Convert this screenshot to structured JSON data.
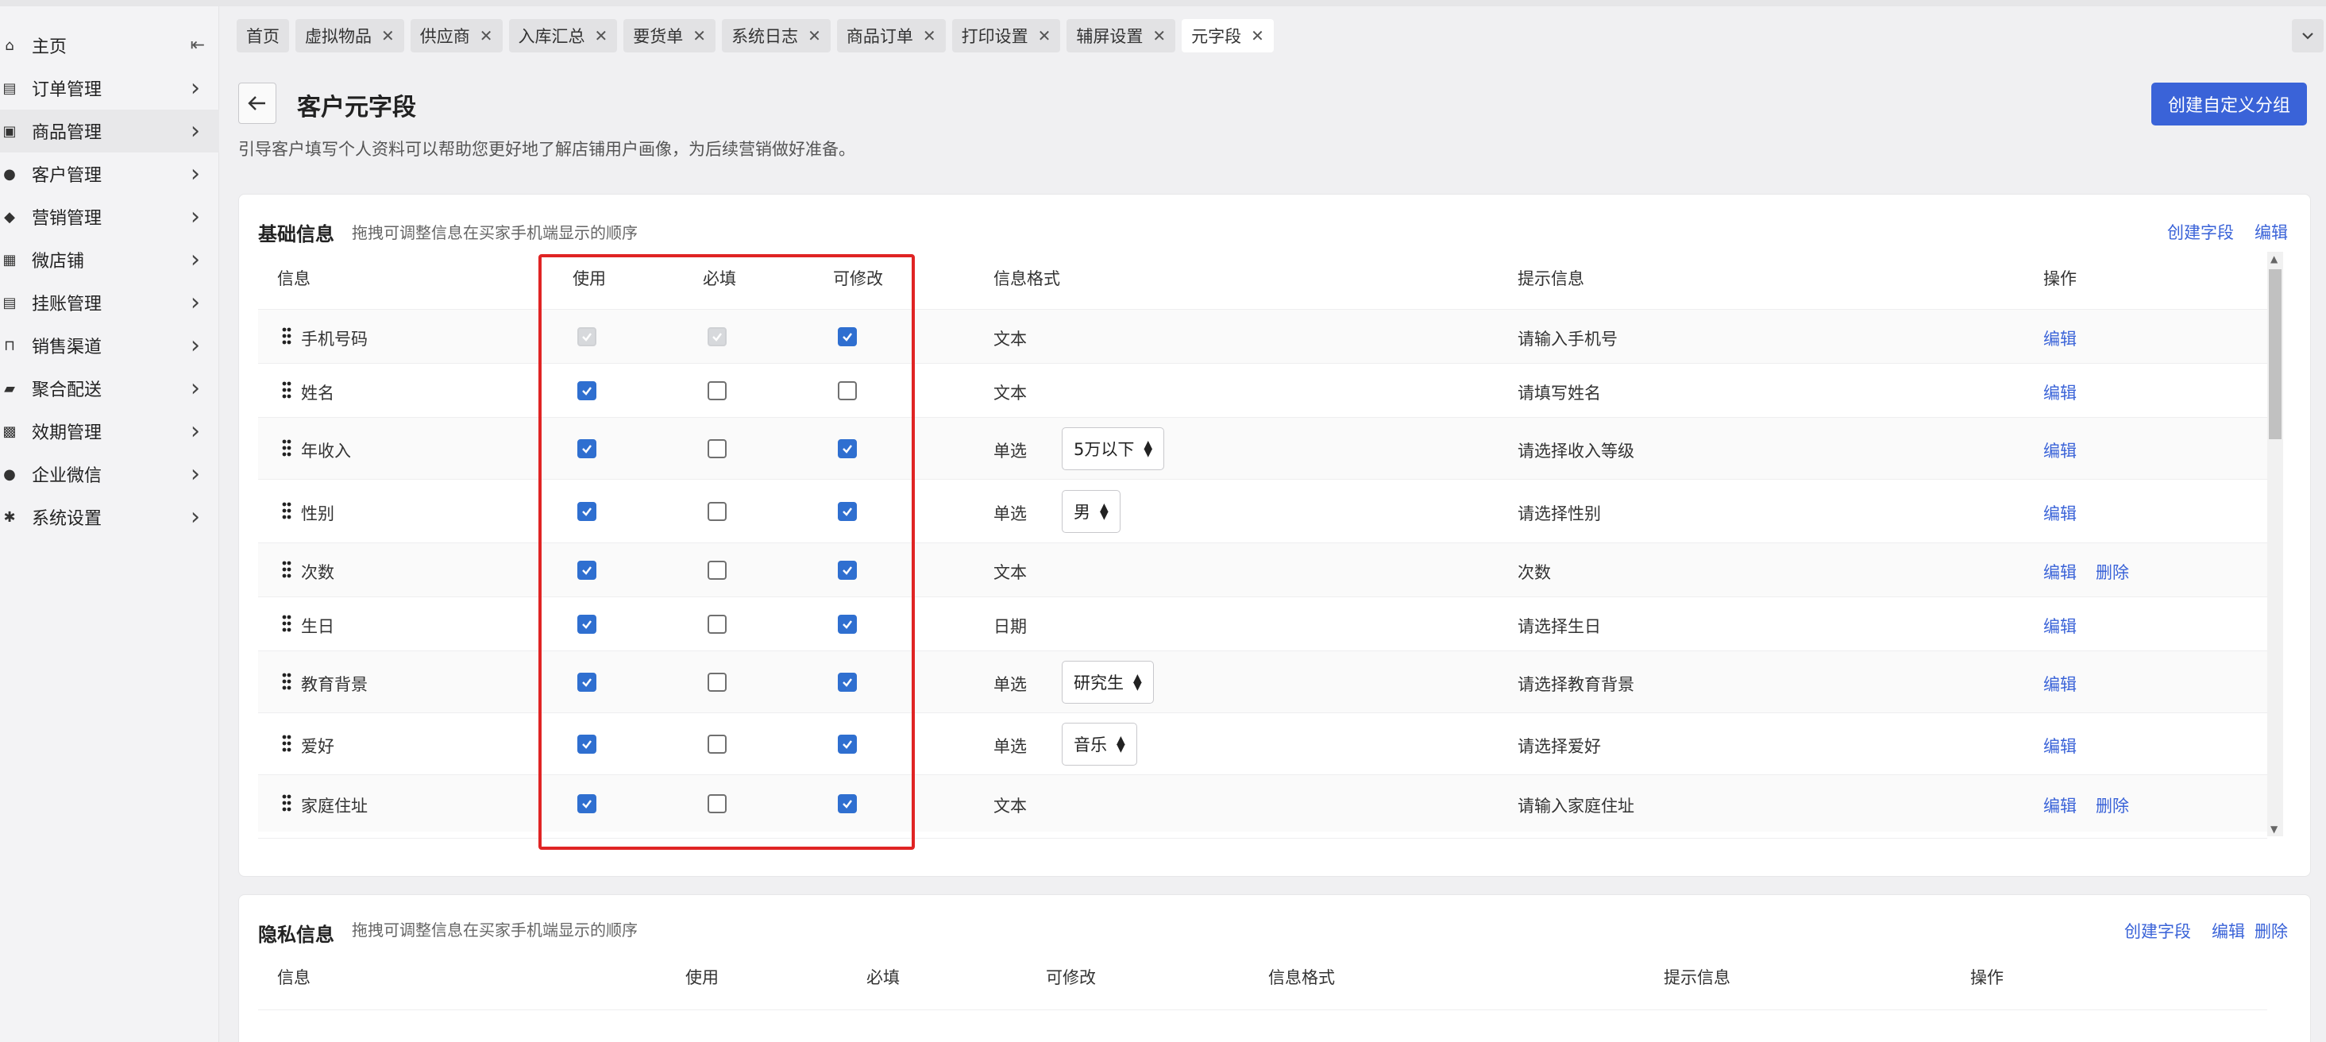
{
  "sidebar": {
    "items": [
      {
        "label": "主页",
        "icon": "home-icon"
      },
      {
        "label": "订单管理",
        "icon": "order-icon"
      },
      {
        "label": "商品管理",
        "icon": "product-icon"
      },
      {
        "label": "客户管理",
        "icon": "user-icon"
      },
      {
        "label": "营销管理",
        "icon": "tag-icon"
      },
      {
        "label": "微店铺",
        "icon": "store-icon"
      },
      {
        "label": "挂账管理",
        "icon": "ledger-icon"
      },
      {
        "label": "销售渠道",
        "icon": "bank-icon"
      },
      {
        "label": "聚合配送",
        "icon": "truck-icon"
      },
      {
        "label": "效期管理",
        "icon": "calendar-icon"
      },
      {
        "label": "企业微信",
        "icon": "chat-icon"
      },
      {
        "label": "系统设置",
        "icon": "gear-icon"
      }
    ]
  },
  "tabs": [
    "首页",
    "虚拟物品",
    "供应商",
    "入库汇总",
    "要货单",
    "系统日志",
    "商品订单",
    "打印设置",
    "辅屏设置",
    "元字段"
  ],
  "header": {
    "title": "客户元字段",
    "description": "引导客户填写个人资料可以帮助您更好地了解店铺用户画像，为后续营销做好准备。",
    "create_group": "创建自定义分组"
  },
  "basic": {
    "title": "基础信息",
    "subtitle": "拖拽可调整信息在买家手机端显示的顺序",
    "create_field": "创建字段",
    "edit": "编辑",
    "columns": {
      "info": "信息",
      "use": "使用",
      "required": "必填",
      "editable": "可修改",
      "format": "信息格式",
      "hint": "提示信息",
      "ops": "操作"
    },
    "rows": [
      {
        "name": "手机号码",
        "use": "disabled",
        "required": "disabled",
        "editable": "on",
        "format": "文本",
        "select": "",
        "hint": "请输入手机号",
        "edit": "编辑",
        "delete": ""
      },
      {
        "name": "姓名",
        "use": "on",
        "required": "off",
        "editable": "off",
        "format": "文本",
        "select": "",
        "hint": "请填写姓名",
        "edit": "编辑",
        "delete": ""
      },
      {
        "name": "年收入",
        "use": "on",
        "required": "off",
        "editable": "on",
        "format": "单选",
        "select": "5万以下",
        "hint": "请选择收入等级",
        "edit": "编辑",
        "delete": ""
      },
      {
        "name": "性别",
        "use": "on",
        "required": "off",
        "editable": "on",
        "format": "单选",
        "select": "男",
        "hint": "请选择性别",
        "edit": "编辑",
        "delete": ""
      },
      {
        "name": "次数",
        "use": "on",
        "required": "off",
        "editable": "on",
        "format": "文本",
        "select": "",
        "hint": "次数",
        "edit": "编辑",
        "delete": "删除"
      },
      {
        "name": "生日",
        "use": "on",
        "required": "off",
        "editable": "on",
        "format": "日期",
        "select": "",
        "hint": "请选择生日",
        "edit": "编辑",
        "delete": ""
      },
      {
        "name": "教育背景",
        "use": "on",
        "required": "off",
        "editable": "on",
        "format": "单选",
        "select": "研究生",
        "hint": "请选择教育背景",
        "edit": "编辑",
        "delete": ""
      },
      {
        "name": "爱好",
        "use": "on",
        "required": "off",
        "editable": "on",
        "format": "单选",
        "select": "音乐",
        "hint": "请选择爱好",
        "edit": "编辑",
        "delete": ""
      },
      {
        "name": "家庭住址",
        "use": "on",
        "required": "off",
        "editable": "on",
        "format": "文本",
        "select": "",
        "hint": "请输入家庭住址",
        "edit": "编辑",
        "delete": "删除"
      }
    ]
  },
  "privacy": {
    "title": "隐私信息",
    "subtitle": "拖拽可调整信息在买家手机端显示的顺序",
    "create_field": "创建字段",
    "edit": "编辑",
    "delete": "删除",
    "columns": {
      "info": "信息",
      "use": "使用",
      "required": "必填",
      "editable": "可修改",
      "format": "信息格式",
      "hint": "提示信息",
      "ops": "操作"
    }
  },
  "colors": {
    "accent": "#3a63d8",
    "checkbox": "#2f6fd0",
    "highlight": "#e02424"
  }
}
